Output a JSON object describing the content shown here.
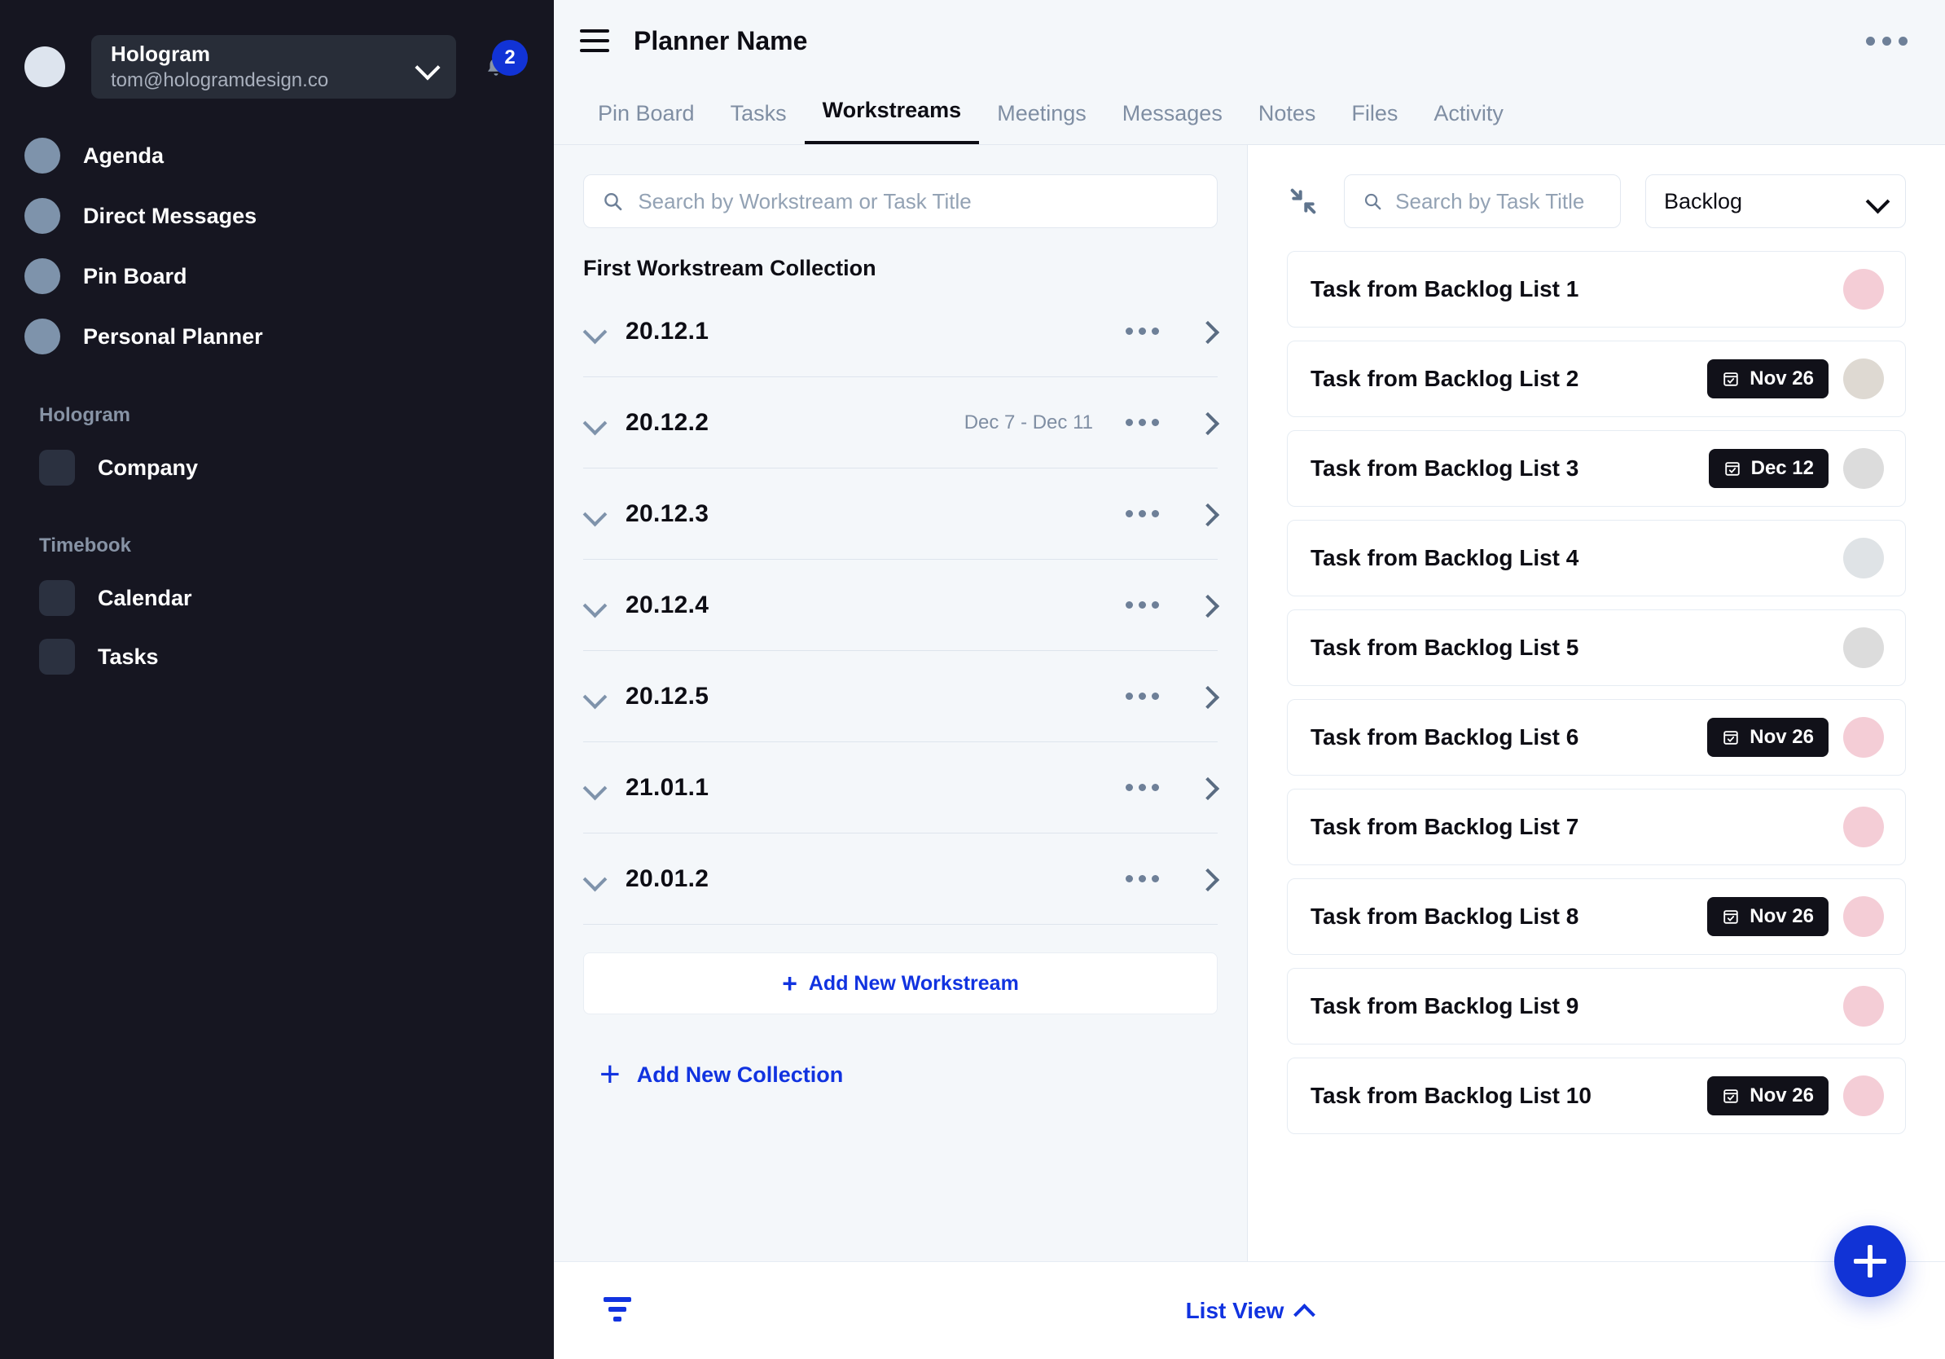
{
  "sidebar": {
    "account": {
      "name": "Hologram",
      "email": "tom@hologramdesign.co",
      "notification_count": "2"
    },
    "nav_items": [
      {
        "label": "Agenda"
      },
      {
        "label": "Direct Messages"
      },
      {
        "label": "Pin Board"
      },
      {
        "label": "Personal Planner"
      }
    ],
    "sections": [
      {
        "title": "Hologram",
        "items": [
          {
            "label": "Company"
          }
        ]
      },
      {
        "title": "Timebook",
        "items": [
          {
            "label": "Calendar"
          },
          {
            "label": "Tasks"
          }
        ]
      }
    ]
  },
  "header": {
    "title": "Planner Name",
    "menu_icon": "hamburger-icon",
    "more_icon": "more-horizontal-icon"
  },
  "tabs": [
    {
      "label": "Pin Board",
      "active": false
    },
    {
      "label": "Tasks",
      "active": false
    },
    {
      "label": "Workstreams",
      "active": true
    },
    {
      "label": "Meetings",
      "active": false
    },
    {
      "label": "Messages",
      "active": false
    },
    {
      "label": "Notes",
      "active": false
    },
    {
      "label": "Files",
      "active": false
    },
    {
      "label": "Activity",
      "active": false
    }
  ],
  "workstreams_panel": {
    "search_placeholder": "Search by Workstream or Task Title",
    "search_value": "",
    "collection_title": "First Workstream Collection",
    "rows": [
      {
        "name": "20.12.1",
        "date": ""
      },
      {
        "name": "20.12.2",
        "date": "Dec 7 - Dec 11"
      },
      {
        "name": "20.12.3",
        "date": ""
      },
      {
        "name": "20.12.4",
        "date": ""
      },
      {
        "name": "20.12.5",
        "date": ""
      },
      {
        "name": "21.01.1",
        "date": ""
      },
      {
        "name": "20.01.2",
        "date": ""
      }
    ],
    "add_workstream_label": "Add New Workstream",
    "add_collection_label": "Add New Collection"
  },
  "tasks_panel": {
    "collapse_icon": "collapse-arrows-icon",
    "search_placeholder": "Search by Task Title",
    "search_value": "",
    "filter_selected": "Backlog",
    "filter_options": [
      "Backlog"
    ],
    "tasks": [
      {
        "title": "Task from Backlog List 1",
        "date": "",
        "avatar_color": "#f4cdd6"
      },
      {
        "title": "Task from Backlog List 2",
        "date": "Nov 26",
        "avatar_color": "#ded9d2"
      },
      {
        "title": "Task from Backlog List 3",
        "date": "Dec 12",
        "avatar_color": "#dcdcdc"
      },
      {
        "title": "Task from Backlog List 4",
        "date": "",
        "avatar_color": "#dfe3e6"
      },
      {
        "title": "Task from Backlog List 5",
        "date": "",
        "avatar_color": "#dcdcdc"
      },
      {
        "title": "Task from Backlog List 6",
        "date": "Nov 26",
        "avatar_color": "#f4cdd6"
      },
      {
        "title": "Task from Backlog List 7",
        "date": "",
        "avatar_color": "#f4cdd6"
      },
      {
        "title": "Task from Backlog List 8",
        "date": "Nov 26",
        "avatar_color": "#f4cdd6"
      },
      {
        "title": "Task from Backlog List 9",
        "date": "",
        "avatar_color": "#f4cdd6"
      },
      {
        "title": "Task from Backlog List 10",
        "date": "Nov 26",
        "avatar_color": "#f4cdd6"
      }
    ]
  },
  "bottom_bar": {
    "filter_icon": "filter-icon",
    "view_label": "List View",
    "fab_icon": "plus-icon"
  },
  "colors": {
    "accent_blue": "#1133d6",
    "sidebar_bg": "#161621",
    "canvas_bg": "#f4f7fa",
    "chip_dark": "#111119"
  }
}
